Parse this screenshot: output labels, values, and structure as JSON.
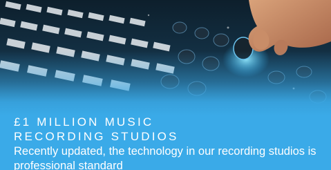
{
  "card": {
    "title": "£1 MILLION MUSIC RECORDING STUDIOS",
    "description": "Recently updated, the technology in our recording studios is professional standard",
    "image_subject": "hand adjusting knobs on a mixing desk",
    "overlay_color": "#3aaae8"
  }
}
